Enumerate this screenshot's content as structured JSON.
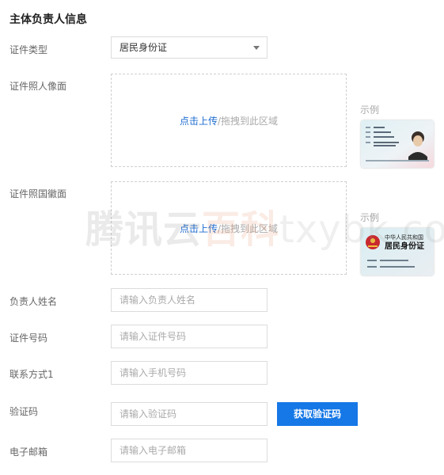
{
  "section": {
    "title": "主体负责人信息"
  },
  "fields": {
    "id_type": {
      "label": "证件类型",
      "value": "居民身份证"
    },
    "photo_front": {
      "label": "证件照人像面",
      "link": "点击上传",
      "hint": "/拖拽到此区域"
    },
    "photo_back": {
      "label": "证件照国徽面",
      "link": "点击上传",
      "hint": "/拖拽到此区域"
    },
    "name": {
      "label": "负责人姓名",
      "placeholder": "请输入负责人姓名"
    },
    "id_number": {
      "label": "证件号码",
      "placeholder": "请输入证件号码"
    },
    "contact": {
      "label": "联系方式1",
      "placeholder": "请输入手机号码"
    },
    "verify_code": {
      "label": "验证码",
      "placeholder": "请输入验证码",
      "button": "获取验证码"
    },
    "email": {
      "label": "电子邮箱",
      "placeholder": "请输入电子邮箱"
    }
  },
  "examples": {
    "front_label": "示例",
    "back_label": "示例",
    "back_card_title": "中华人民共和国",
    "back_card_name": "居民身份证"
  },
  "watermark": {
    "part1": "腾讯云",
    "part2": "百科",
    "part3": "txybk.com"
  },
  "colors": {
    "accent": "#1677e6",
    "link": "#1d6cd1",
    "border": "#dcdcdc"
  }
}
